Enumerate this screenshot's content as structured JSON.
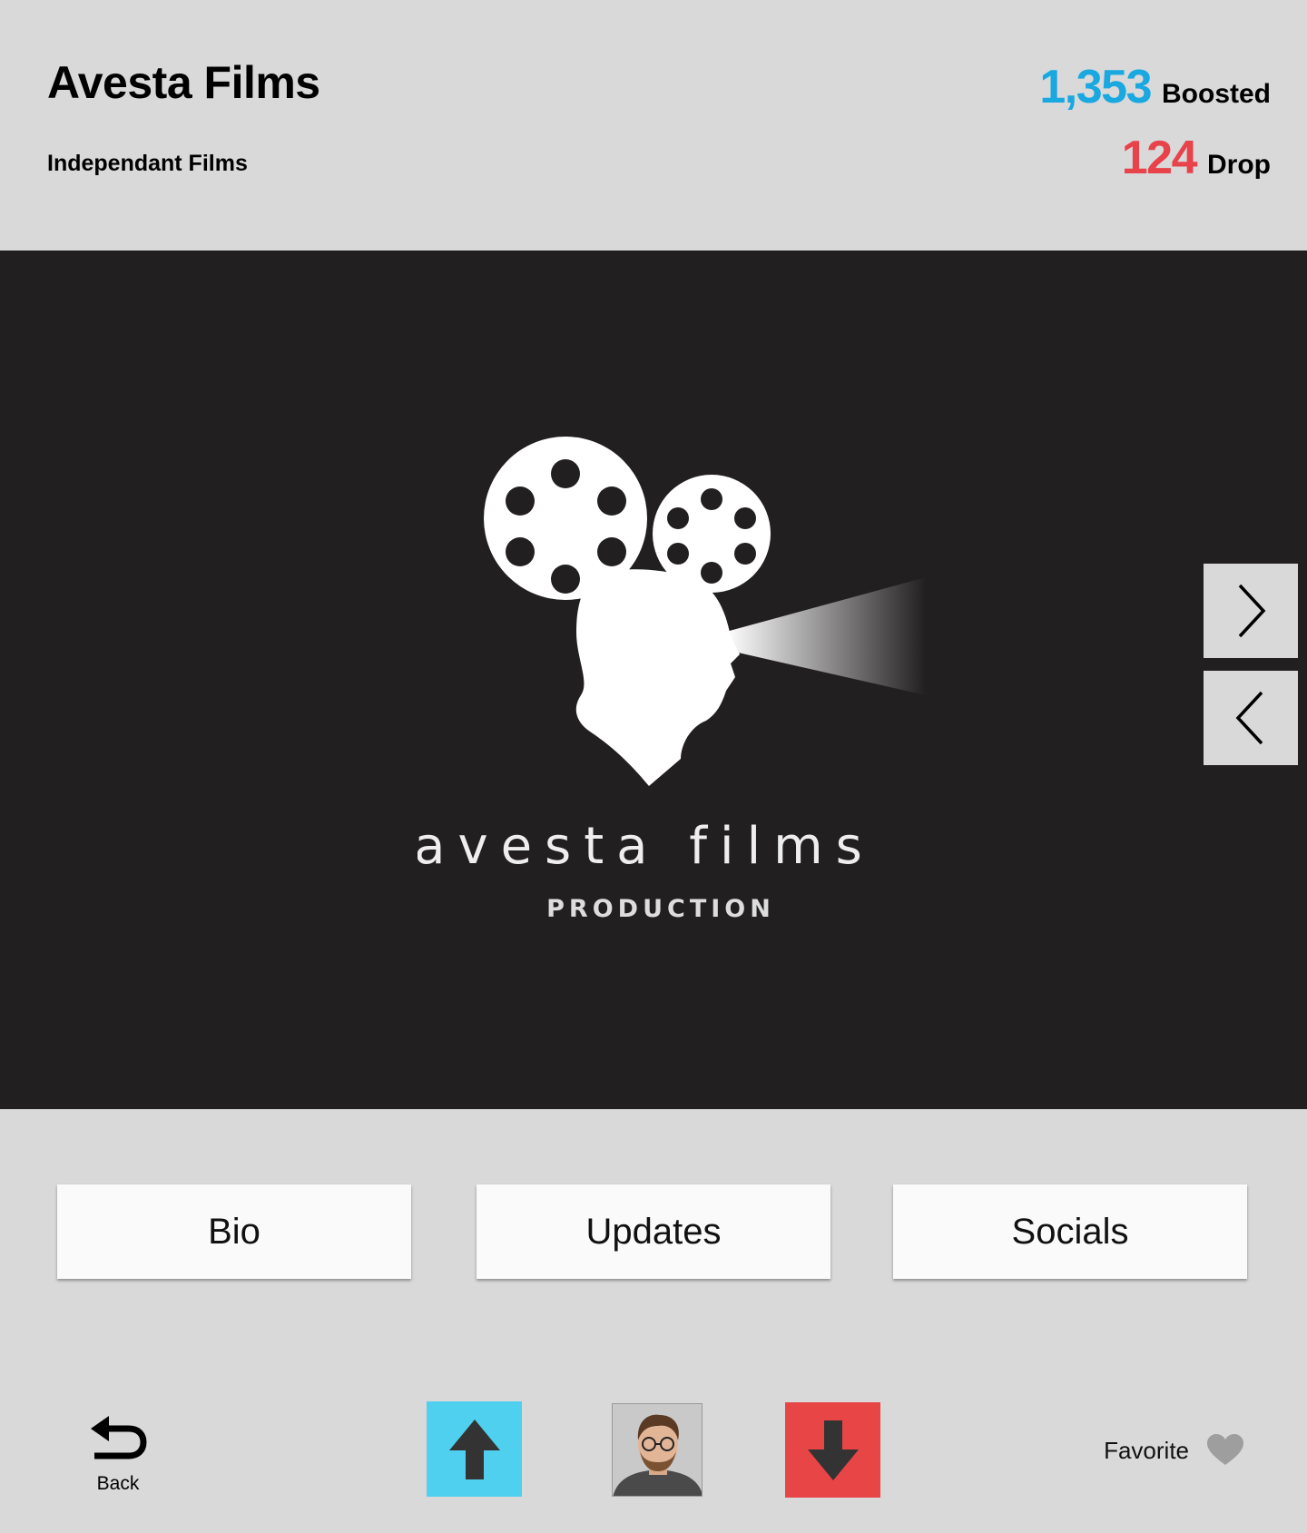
{
  "header": {
    "title": "Avesta Films",
    "subtitle": "Independant Films",
    "boosted": {
      "count": "1,353",
      "label": "Boosted",
      "color": "#1aa8e0"
    },
    "drop": {
      "count": "124",
      "label": "Drop",
      "color": "#e8424a"
    }
  },
  "media": {
    "logo_text": "avesta films",
    "logo_subtext": "PRODUCTION",
    "next_icon": "chevron-right-icon",
    "prev_icon": "chevron-left-icon"
  },
  "tabs": [
    {
      "label": "Bio"
    },
    {
      "label": "Updates"
    },
    {
      "label": "Socials"
    }
  ],
  "footer": {
    "back_label": "Back",
    "boost_icon": "arrow-up-icon",
    "drop_icon": "arrow-down-icon",
    "favorite_label": "Favorite",
    "favorite_icon": "heart-icon"
  },
  "colors": {
    "background": "#d9d9d9",
    "media_background": "#221f20",
    "boost_button": "#4fd0ee",
    "drop_button": "#e84546"
  }
}
